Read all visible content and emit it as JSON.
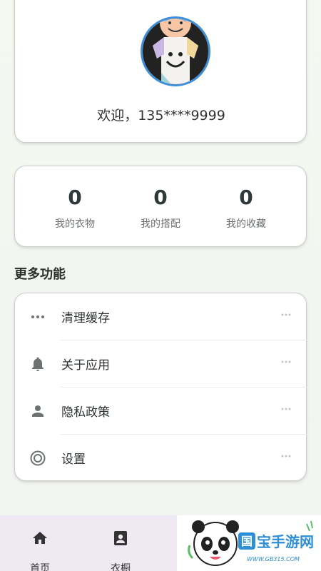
{
  "profile": {
    "welcome_text": "欢迎，135****9999"
  },
  "stats": [
    {
      "value": "0",
      "label": "我的衣物"
    },
    {
      "value": "0",
      "label": "我的搭配"
    },
    {
      "value": "0",
      "label": "我的收藏"
    }
  ],
  "section_title": "更多功能",
  "menu": [
    {
      "label": "清理缓存",
      "icon": "more-horiz-icon"
    },
    {
      "label": "关于应用",
      "icon": "bell-icon"
    },
    {
      "label": "隐私政策",
      "icon": "person-icon"
    },
    {
      "label": "设置",
      "icon": "radio-target-icon"
    }
  ],
  "bottom_nav": [
    {
      "label": "首页",
      "icon": "home-icon"
    },
    {
      "label": "衣橱",
      "icon": "contact-card-icon"
    }
  ],
  "watermark": {
    "brand": "国宝手游网",
    "url": "WWW.GB315.COM"
  },
  "colors": {
    "avatar_border": "#3f8fd8",
    "icon_gray": "#6e7370",
    "nav_bg": "#efe9f4"
  }
}
